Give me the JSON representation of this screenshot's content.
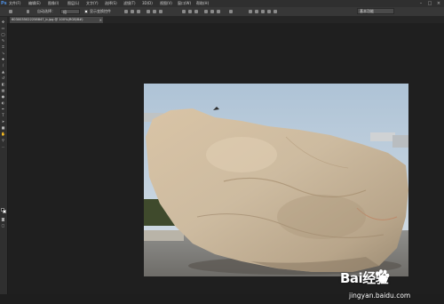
{
  "app": {
    "logo": "Ps"
  },
  "menubar": {
    "items": [
      "文件(F)",
      "编辑(E)",
      "图像(I)",
      "图层(L)",
      "文字(Y)",
      "选择(S)",
      "滤镜(T)",
      "3D(D)",
      "视图(V)",
      "窗口(W)",
      "帮助(H)"
    ],
    "window_controls": [
      "–",
      "□",
      "×"
    ]
  },
  "options_bar": {
    "auto_select_label": "自动选择：",
    "auto_select_value": "组",
    "show_transform_label": "显示变换控件",
    "show_transform_checked": true,
    "workspace": "基本功能"
  },
  "document_tab": {
    "title": "6030035022258847_b.jpg @ 100%(RGB/8#)",
    "close": "×"
  },
  "watermark": {
    "brand": "Bai经验",
    "url": "jingyan.baidu.com"
  },
  "icons": {
    "toolbar": [
      "move-tool-icon",
      "marquee-tool-icon",
      "lasso-tool-icon",
      "quick-select-tool-icon",
      "crop-tool-icon",
      "eyedropper-tool-icon",
      "healing-brush-tool-icon",
      "brush-tool-icon",
      "clone-stamp-tool-icon",
      "history-brush-tool-icon",
      "eraser-tool-icon",
      "gradient-tool-icon",
      "blur-tool-icon",
      "dodge-tool-icon",
      "pen-tool-icon",
      "type-tool-icon",
      "path-select-tool-icon",
      "shape-tool-icon",
      "hand-tool-icon",
      "zoom-tool-icon"
    ]
  },
  "colors": {
    "foreground": "#000000",
    "background": "#ffffff"
  }
}
